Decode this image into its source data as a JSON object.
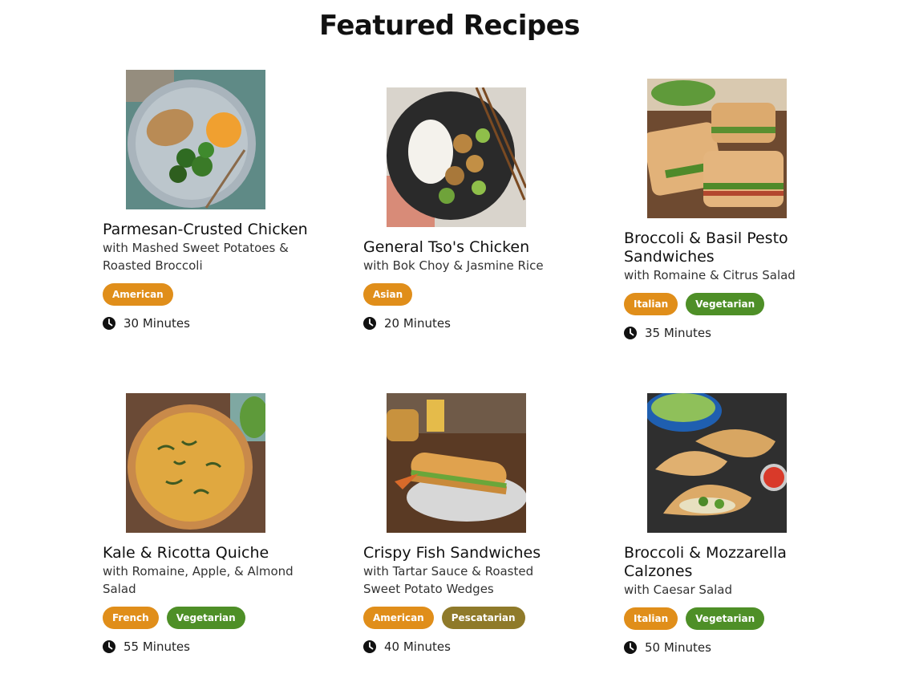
{
  "page": {
    "title": "Featured Recipes"
  },
  "colors": {
    "american": "#e08e1a",
    "asian": "#e08e1a",
    "italian": "#e08e1a",
    "french": "#e08e1a",
    "vegetarian": "#4e8f27",
    "pescatarian": "#8f7a2a"
  },
  "recipes": [
    {
      "name": "Parmesan-Crusted Chicken",
      "subtitle": "with Mashed Sweet Potatoes & Roasted Broccoli",
      "image": "chicken-plate-image",
      "tags": [
        {
          "label": "American",
          "color": "#e08e1a"
        }
      ],
      "time": "30 Minutes"
    },
    {
      "name": "General Tso's Chicken",
      "subtitle": "with Bok Choy & Jasmine Rice",
      "image": "stir-fry-image",
      "tags": [
        {
          "label": "Asian",
          "color": "#e08e1a"
        }
      ],
      "time": "20 Minutes"
    },
    {
      "name": "Broccoli & Basil Pesto Sandwiches",
      "subtitle": "with Romaine & Citrus Salad",
      "image": "sandwich-image",
      "tags": [
        {
          "label": "Italian",
          "color": "#e08e1a"
        },
        {
          "label": "Vegetarian",
          "color": "#4e8f27"
        }
      ],
      "time": "35 Minutes"
    },
    {
      "name": "Kale & Ricotta Quiche",
      "subtitle": "with Romaine, Apple, & Almond Salad",
      "image": "quiche-image",
      "tags": [
        {
          "label": "French",
          "color": "#e08e1a"
        },
        {
          "label": "Vegetarian",
          "color": "#4e8f27"
        }
      ],
      "time": "55 Minutes"
    },
    {
      "name": "Crispy Fish Sandwiches",
      "subtitle": "with Tartar Sauce & Roasted Sweet Potato Wedges",
      "image": "fish-sandwich-image",
      "tags": [
        {
          "label": "American",
          "color": "#e08e1a"
        },
        {
          "label": "Pescatarian",
          "color": "#8f7a2a"
        }
      ],
      "time": "40 Minutes"
    },
    {
      "name": "Broccoli & Mozzarella Calzones",
      "subtitle": "with Caesar Salad",
      "image": "calzone-image",
      "tags": [
        {
          "label": "Italian",
          "color": "#e08e1a"
        },
        {
          "label": "Vegetarian",
          "color": "#4e8f27"
        }
      ],
      "time": "50 Minutes"
    }
  ]
}
